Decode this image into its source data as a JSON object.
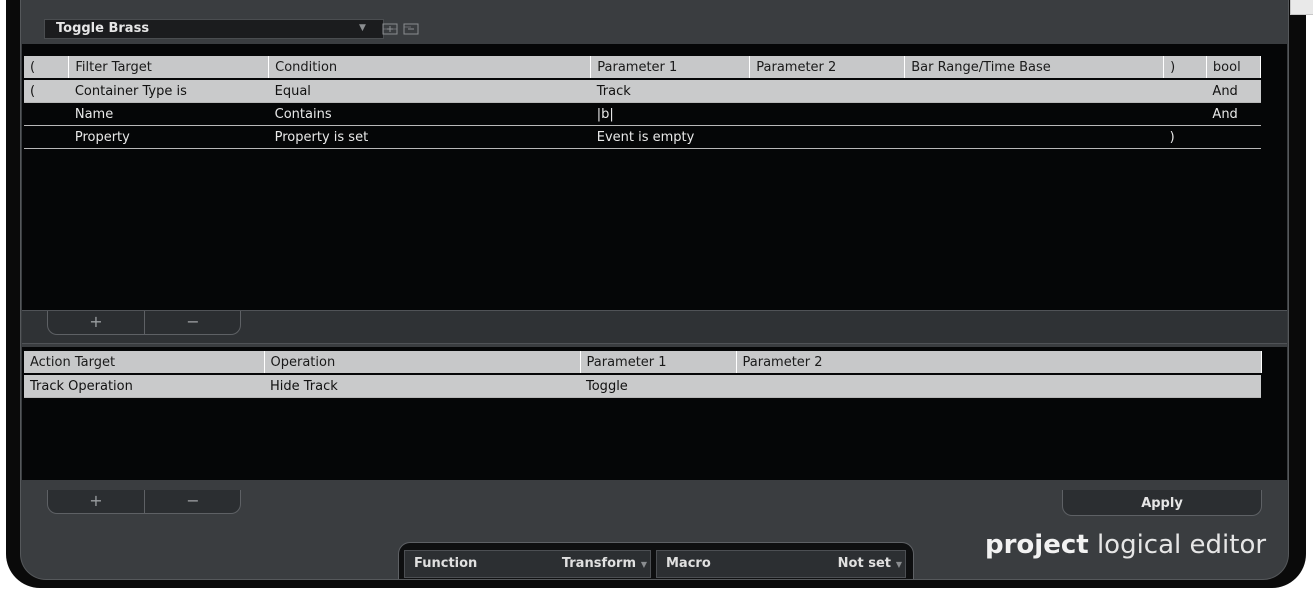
{
  "preset": {
    "name": "Toggle Brass",
    "icons": [
      "dropdown-arrow-icon",
      "store-preset-icon",
      "remove-preset-icon"
    ]
  },
  "filter": {
    "columns": [
      "(",
      "Filter Target",
      "Condition",
      "Parameter 1",
      "Parameter 2",
      "Bar Range/Time Base",
      ")",
      "bool"
    ],
    "rows": [
      [
        "(",
        "Container Type is",
        "Equal",
        "Track",
        "",
        "",
        "",
        "And"
      ],
      [
        "",
        "Name",
        "Contains",
        "|b|",
        "",
        "",
        "",
        "And"
      ],
      [
        "",
        "Property",
        "Property is set",
        "Event is empty",
        "",
        "",
        ")",
        ""
      ]
    ],
    "add_label": "+",
    "remove_label": "−"
  },
  "action": {
    "columns": [
      "Action Target",
      "Operation",
      "Parameter 1",
      "Parameter 2"
    ],
    "rows": [
      [
        "Track Operation",
        "Hide Track",
        "Toggle",
        ""
      ]
    ],
    "add_label": "+",
    "remove_label": "−"
  },
  "apply_label": "Apply",
  "function": {
    "label": "Function",
    "value": "Transform"
  },
  "macro": {
    "label": "Macro",
    "value": "Not set"
  },
  "brand": {
    "bold": "project",
    "rest": " logical editor"
  },
  "colors": {
    "selected_row": "#c9cacb",
    "header": "#c7c8c9",
    "panel_bg": "#050607",
    "frame": "#3a3d40"
  }
}
